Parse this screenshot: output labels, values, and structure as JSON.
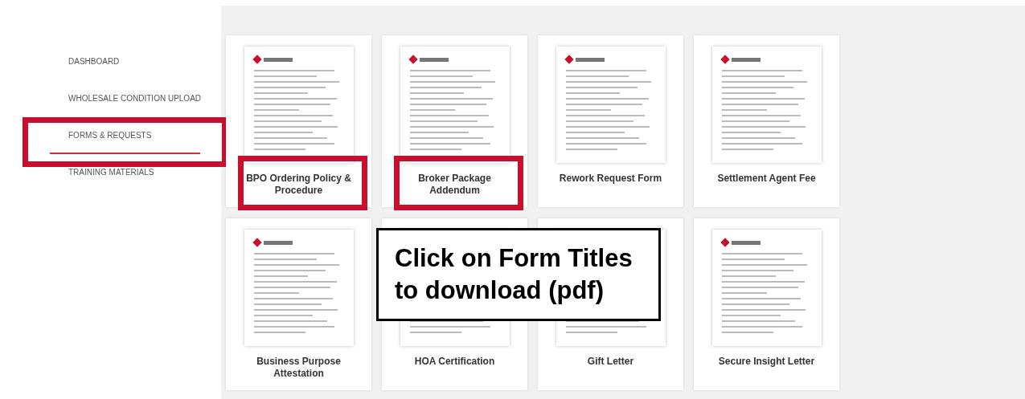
{
  "sidebar": {
    "items": [
      {
        "label": "DASHBOARD",
        "selected": false,
        "highlighted": false
      },
      {
        "label": "WHOLESALE CONDITION UPLOAD",
        "selected": false,
        "highlighted": false
      },
      {
        "label": "FORMS & REQUESTS",
        "selected": true,
        "highlighted": true
      },
      {
        "label": "TRAINING MATERIALS",
        "selected": false,
        "highlighted": false
      }
    ]
  },
  "forms": [
    {
      "title": "BPO Ordering Policy & Procedure",
      "highlighted": true
    },
    {
      "title": "Broker Package Addendum",
      "highlighted": true
    },
    {
      "title": "Rework Request Form",
      "highlighted": false
    },
    {
      "title": "Settlement Agent Fee",
      "highlighted": false
    },
    {
      "title": "Business Purpose Attestation",
      "highlighted": false
    },
    {
      "title": "HOA Certification",
      "highlighted": false
    },
    {
      "title": "Gift Letter",
      "highlighted": false
    },
    {
      "title": "Secure Insight Letter",
      "highlighted": false
    }
  ],
  "callout": {
    "text": "Click on Form Titles to download (pdf)"
  }
}
